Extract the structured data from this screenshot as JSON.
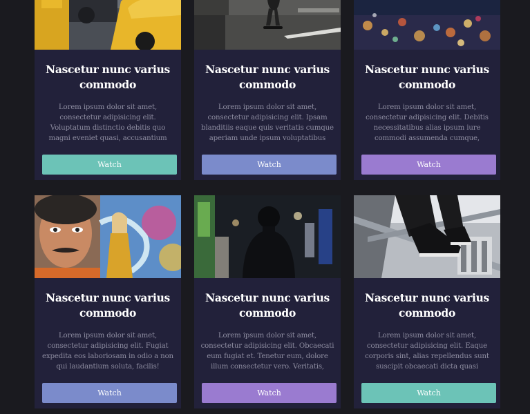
{
  "cards": [
    {
      "title": "Nascetur nunc varius commodo",
      "text": "Lorem ipsum dolor sit amet, consectetur adipisicing elit. Voluptatum distinctio debitis quo magni eveniet quasi, accusantium fugiat eius ducimus enim.",
      "button": "Watch",
      "button_color": "#6cc3b7",
      "image": "taxi-street-photo"
    },
    {
      "title": "Nascetur nunc varius commodo",
      "text": "Lorem ipsum dolor sit amet, consectetur adipisicing elit. Ipsam blanditiis eaque quis veritatis cumque aperiam unde ipsum voluptatibus possimus et.",
      "button": "Watch",
      "button_color": "#7b8bcb",
      "image": "skateboarder-photo"
    },
    {
      "title": "Nascetur nunc varius commodo",
      "text": "Lorem ipsum dolor sit amet, consectetur adipisicing elit. Debitis necessitatibus alias ipsum iure commodi assumenda cumque, voluptatem ipsa autem in?",
      "button": "Watch",
      "button_color": "#9a7bd0",
      "image": "city-lights-bokeh-photo"
    },
    {
      "title": "Nascetur nunc varius commodo",
      "text": "Lorem ipsum dolor sit amet, consectetur adipisicing elit. Fugiat expedita eos laboriosam in odio a non qui laudantium soluta, facilis!",
      "button": "Watch",
      "button_color": "#7b8bcb",
      "image": "graffiti-wall-photo"
    },
    {
      "title": "Nascetur nunc varius commodo",
      "text": "Lorem ipsum dolor sit amet, consectetur adipisicing elit. Obcaecati eum fugiat et. Tenetur eum, dolore illum consectetur vero. Veritatis, provident!",
      "button": "Watch",
      "button_color": "#9a7bd0",
      "image": "night-street-silhouette-photo"
    },
    {
      "title": "Nascetur nunc varius commodo",
      "text": "Lorem ipsum dolor sit amet, consectetur adipisicing elit. Eaque corporis sint, alias repellendus sunt suscipit obcaecati dicta quasi laudantium, accusantium.",
      "button": "Watch",
      "button_color": "#6cc3b7",
      "image": "sneakers-stairs-photo"
    }
  ]
}
